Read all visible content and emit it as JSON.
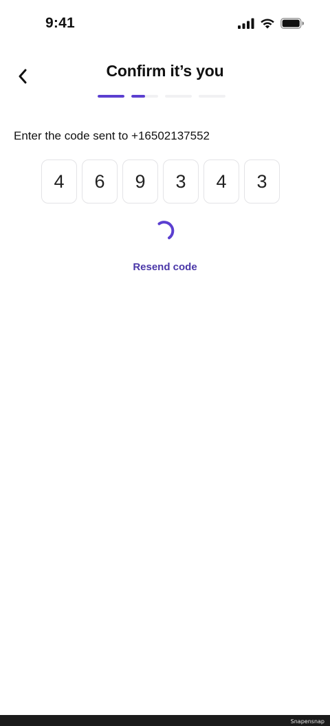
{
  "status_bar": {
    "time": "9:41",
    "icons": [
      "cellular-signal-icon",
      "wifi-icon",
      "battery-icon"
    ]
  },
  "header": {
    "back_icon": "chevron-left-icon",
    "title": "Confirm it’s you"
  },
  "progress": {
    "steps_total": 4,
    "segments": [
      {
        "fill": 1.0
      },
      {
        "fill": 0.5
      },
      {
        "fill": 0.0
      },
      {
        "fill": 0.0
      }
    ]
  },
  "instruction": "Enter the code sent to +16502137552",
  "code_digits": [
    "4",
    "6",
    "9",
    "3",
    "4",
    "3"
  ],
  "loading_icon": "spinner-icon",
  "resend_label": "Resend code",
  "watermark": "Snapensnap",
  "colors": {
    "accent": "#5b3fd0",
    "link": "#4a37a8",
    "box_border": "#e3e3e6",
    "track": "#f1f1f3"
  }
}
